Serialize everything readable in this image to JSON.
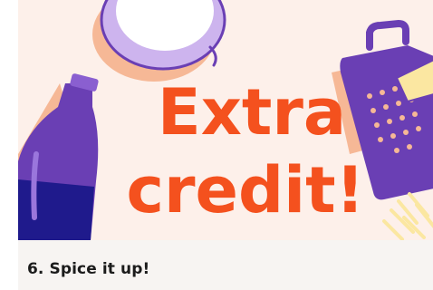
{
  "card": {
    "hero": {
      "headline_line1": "Extra",
      "headline_line2": "credit!",
      "illustrations": [
        "bowl-illustration",
        "wine-bottle-illustration",
        "cheese-grater-illustration"
      ]
    },
    "title": "6. Spice it up!"
  },
  "colors": {
    "hero_background": "#fdf0ea",
    "headline": "#f4511e",
    "bottle_purple": "#6a3fb4",
    "wine_navy": "#1f1a8c",
    "peach_shadow": "#f6b896",
    "grater_purple": "#6a3fb4",
    "cheese_yellow": "#fbe7a1",
    "footer_background": "#f7f4f2",
    "title_text": "#1b1b1b"
  }
}
